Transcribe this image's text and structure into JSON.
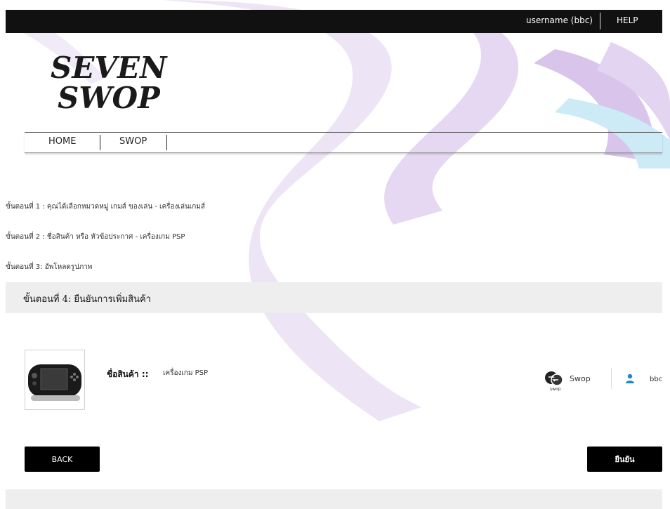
{
  "topbar": {
    "username": "username (bbc)",
    "help": "HELP"
  },
  "logo": {
    "line1": "SEVEN",
    "line2": "SWOP"
  },
  "nav": {
    "items": [
      "HOME",
      "SWOP"
    ]
  },
  "steps": [
    "ขั้นตอนที่ 1 : คุณได้เลือกหมวดหมู่ เกมส์ ของเล่น - เครื่องเล่นเกมส์",
    "ขั้นตอนที่ 2 : ชื่อสินค้า หรือ หัวข้อประกาศ - เครื่องเกม PSP",
    "ขั้นตอนที่ 3: อัพโหลดรูปภาพ"
  ],
  "step4": "ขั้นตอนที่ 4: ยืนยันการเพิ่มสินค้า",
  "product": {
    "label": "ชื่อสินค้า ::",
    "name": "เครื่องเกม PSP",
    "swop_icon_caption": "swop"
  },
  "meta": {
    "type": "Swop",
    "user": "bbc"
  },
  "buttons": {
    "back": "BACK",
    "confirm": "ยืนยัน"
  },
  "colors": {
    "accent_purple": "#d6c2ea",
    "accent_blue": "#b9e2f4",
    "topbar": "#111111",
    "button": "#000000"
  }
}
